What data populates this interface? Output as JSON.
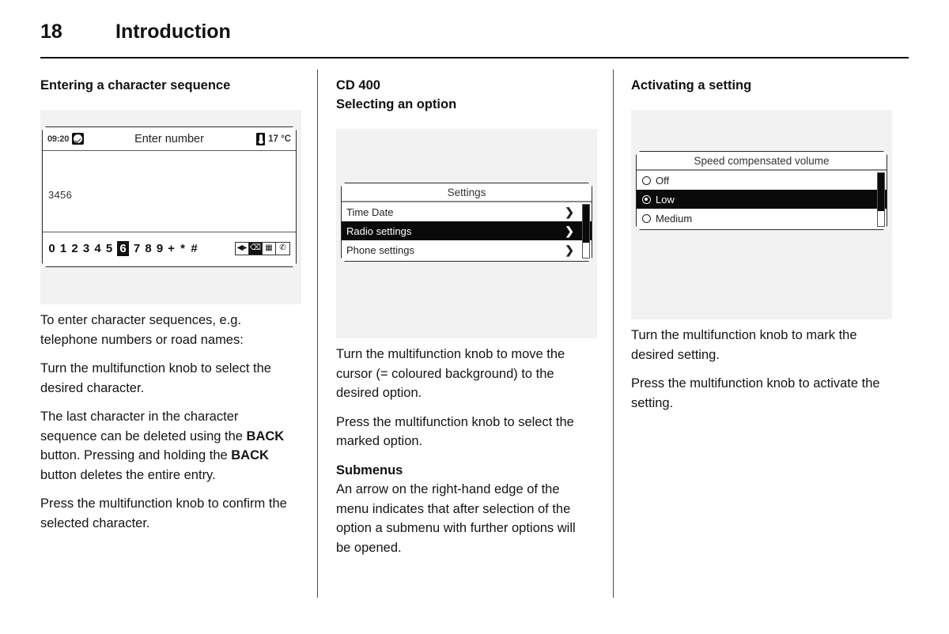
{
  "header": {
    "page_number": "18",
    "title": "Introduction"
  },
  "columns": {
    "left": {
      "heading": "Entering a character sequence",
      "figure": {
        "status": {
          "time": "09:20",
          "clock_icon": "clock-icon",
          "title": "Enter number",
          "thermo_icon": "thermometer-icon",
          "temperature": "17 °C"
        },
        "entered_number": "3456",
        "characters": [
          "0",
          "1",
          "2",
          "3",
          "4",
          "5",
          "6",
          "7",
          "8",
          "9",
          "+",
          "*",
          "#"
        ],
        "selected_character": "6",
        "action_icons": [
          "arrows-icon",
          "backspace-icon",
          "keyboard-icon",
          "phone-handset-icon"
        ]
      },
      "paragraphs": [
        "To enter character sequences, e.g. telephone numbers or road names:",
        "Turn the multifunction knob to select the desired character."
      ],
      "back_paragraph": {
        "part1": "The last character in the character sequence can be deleted using the ",
        "bold1": "BACK",
        "part2": " button. Pressing and holding the ",
        "bold2": "BACK",
        "part3": " button deletes the entire entry."
      },
      "paragraph_last": "Press the multifunction knob to confirm the selected character."
    },
    "middle": {
      "heading": "CD 400\nSelecting an option",
      "figure": {
        "menu_title": "Settings",
        "items": [
          {
            "label": "Time Date",
            "arrow": "chevron-right-icon",
            "selected": false
          },
          {
            "label": "Radio settings",
            "arrow": "chevron-right-icon",
            "selected": true
          },
          {
            "label": "Phone settings",
            "arrow": "chevron-right-icon",
            "selected": false
          }
        ]
      },
      "paragraphs": [
        "Turn the multifunction knob to move the cursor (= coloured background) to the desired option.",
        "Press the multifunction knob to select the marked option."
      ],
      "sub_heading": "Submenus",
      "sub_paragraph": "An arrow on the right-hand edge of the menu indicates that after selection of the option a submenu with further options will be opened."
    },
    "right": {
      "heading": "Activating a setting",
      "figure": {
        "menu_title": "Speed compensated volume",
        "options": [
          {
            "label": "Off",
            "selected": false
          },
          {
            "label": "Low",
            "selected": true
          },
          {
            "label": "Medium",
            "selected": false
          }
        ]
      },
      "paragraphs": [
        "Turn the multifunction knob to mark the desired setting.",
        "Press the multifunction knob to activate the setting."
      ]
    }
  },
  "colors": {
    "ink": "#111111",
    "plate": "#f2f2f2",
    "highlight": "#0a0a0a"
  }
}
